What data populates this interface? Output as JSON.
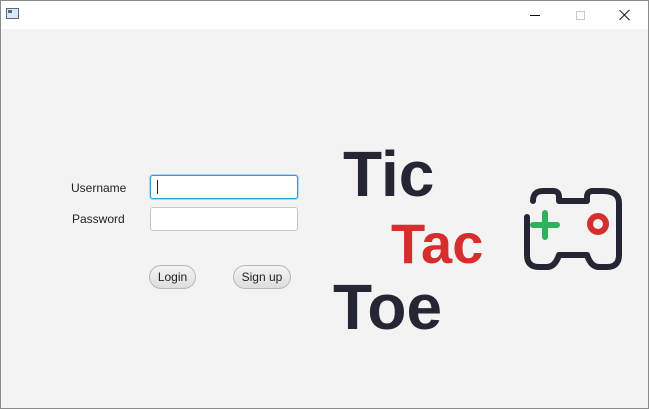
{
  "window": {
    "icons": {
      "app": "app-window-icon",
      "minimize": "minimize-icon",
      "maximize": "maximize-icon",
      "close": "close-icon"
    }
  },
  "login_form": {
    "username_label": "Username",
    "password_label": "Password",
    "username_value": "",
    "password_value": "",
    "login_button": "Login",
    "signup_button": "Sign up"
  },
  "logo": {
    "line1": "Tic",
    "line2": "Tac",
    "line3": "Toe",
    "icon": "gamepad-icon",
    "colors": {
      "dark": "#242733",
      "red": "#d62d2d",
      "green": "#2fb35a"
    }
  }
}
